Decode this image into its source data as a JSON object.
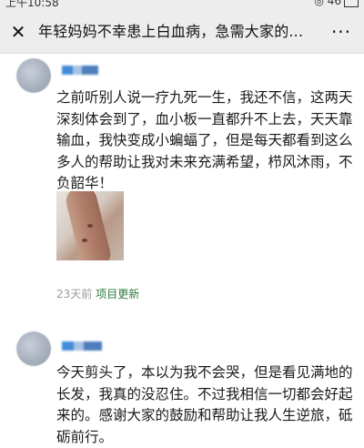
{
  "status_bar": {
    "time": "上午10:58",
    "right": "◎ 46"
  },
  "nav": {
    "title": "年轻妈妈不幸患上白血病，急需大家的..."
  },
  "posts": [
    {
      "text": "之前听别人说一疗九死一生，我还不信，这两天深刻体会到了，血小板一直都升不上去，天天靠输血，我快变成小蝙蝠了，但是每天都看到这么多人的帮助让我对未来充满希望，栉风沐雨，不负韶华！",
      "time": "23天前",
      "tag": "项目更新"
    },
    {
      "text": "今天剪头了，本以为我不会哭，但是看见满地的长发，我真的没忍住。不过我相信一切都会好起来的。感谢大家的鼓励和帮助让我人生逆旅，砥砺前行。"
    }
  ]
}
